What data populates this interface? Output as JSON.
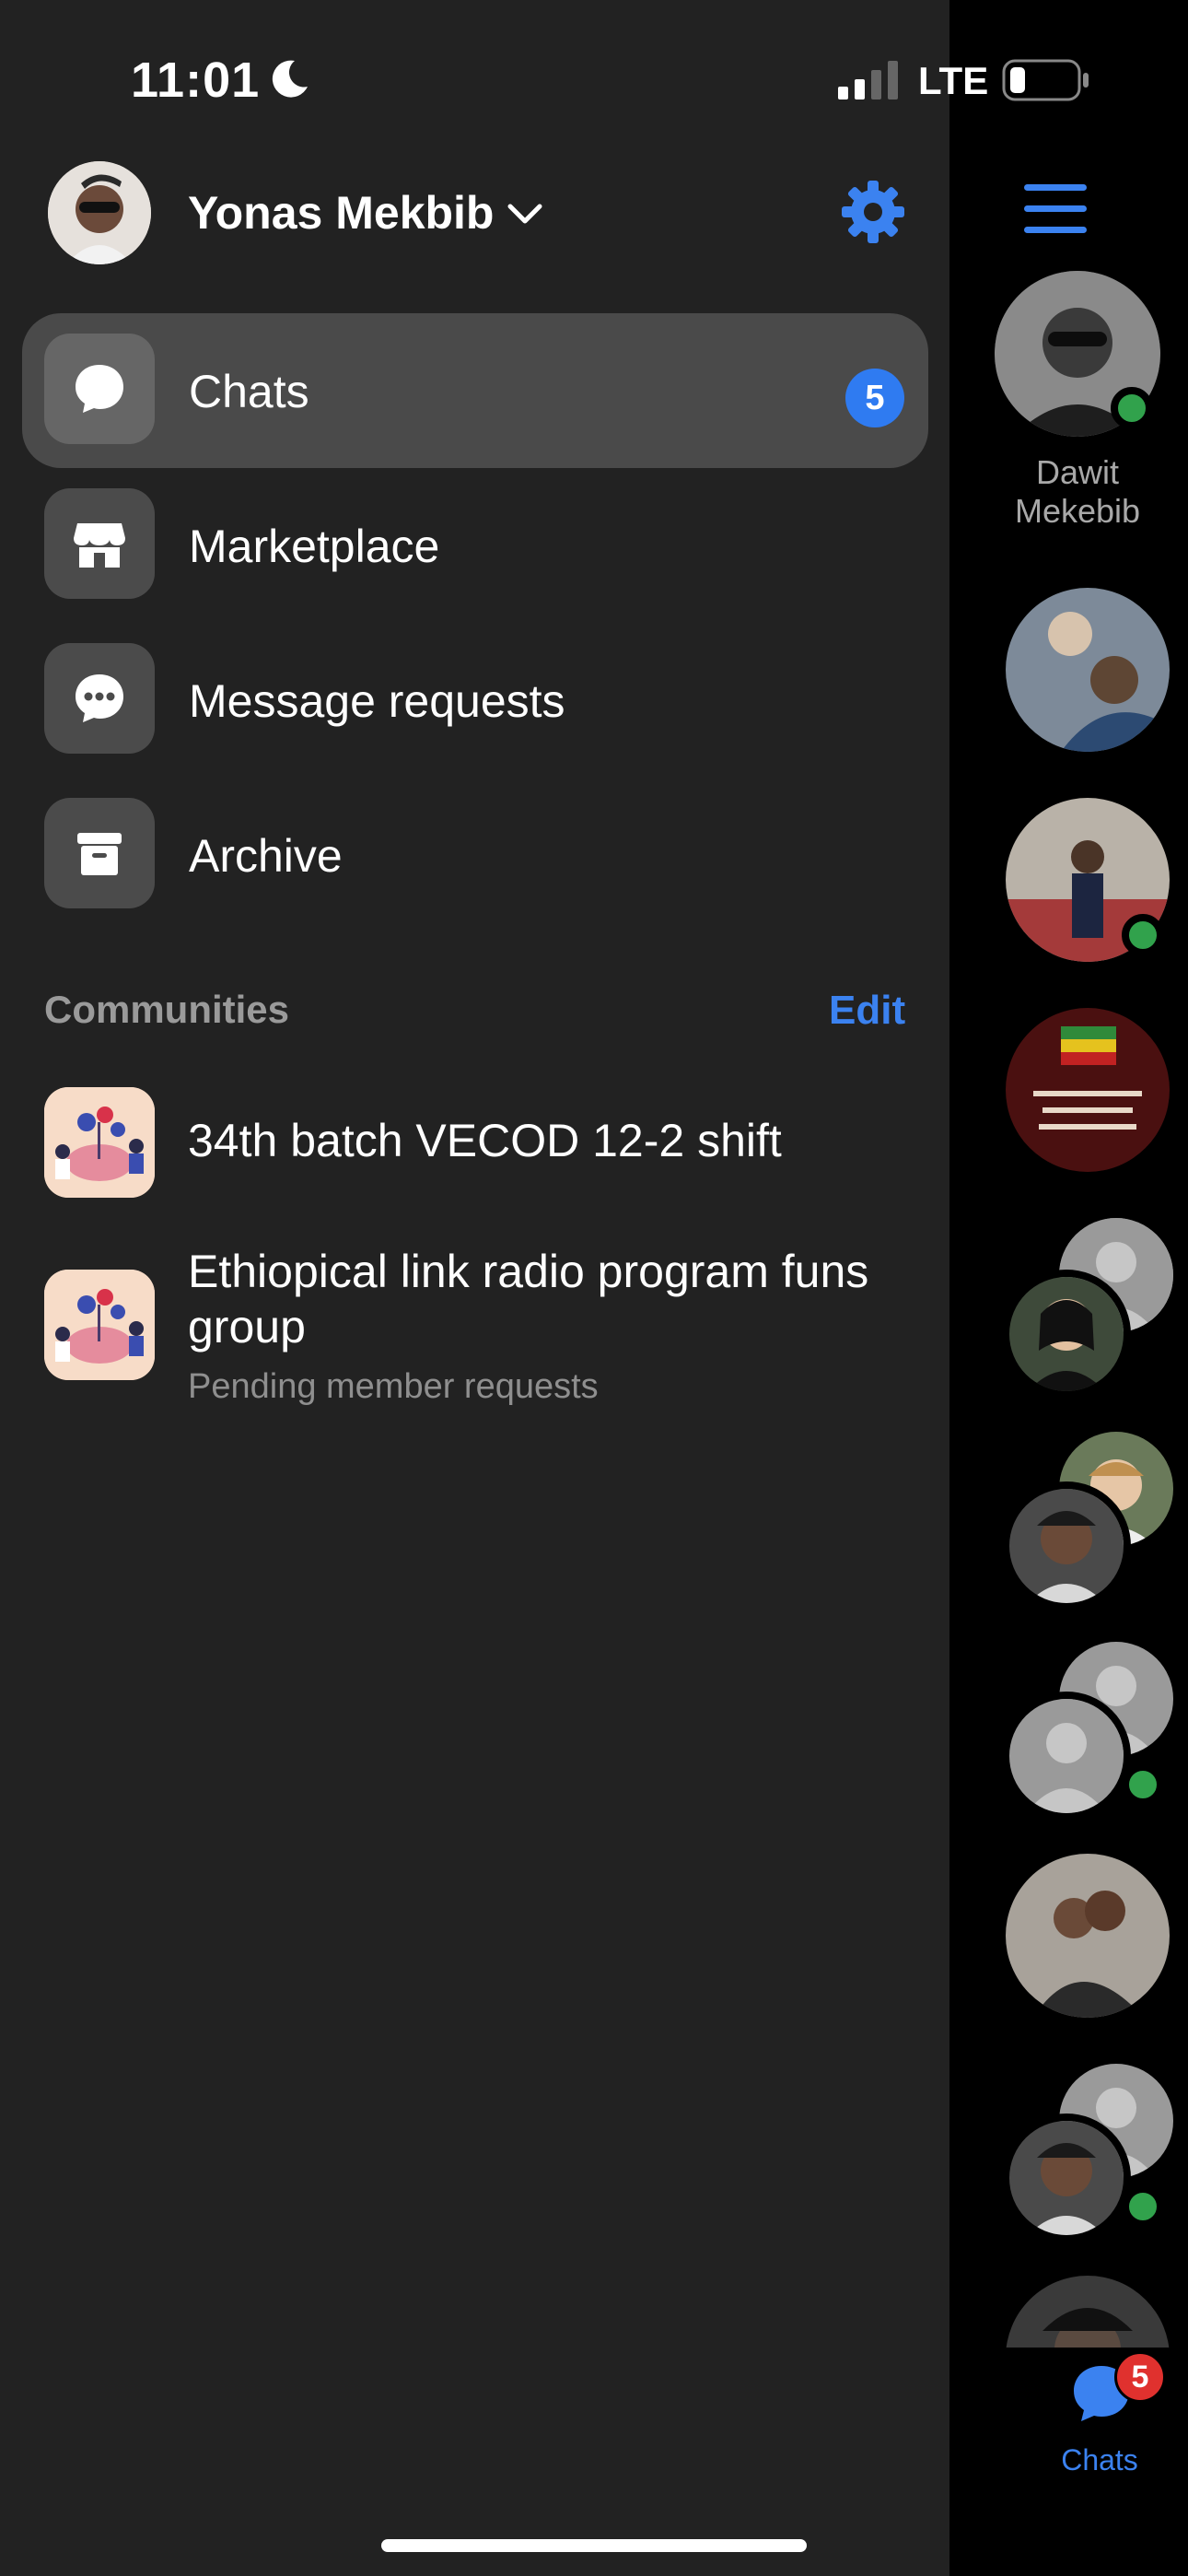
{
  "status_bar": {
    "time": "11:01",
    "network": "LTE"
  },
  "profile": {
    "name": "Yonas Mekbib"
  },
  "menu": [
    {
      "label": "Chats",
      "badge": "5",
      "icon": "chat-bubble-icon"
    },
    {
      "label": "Marketplace",
      "icon": "storefront-icon"
    },
    {
      "label": "Message requests",
      "icon": "message-dots-icon"
    },
    {
      "label": "Archive",
      "icon": "archive-box-icon"
    }
  ],
  "communities": {
    "title": "Communities",
    "edit_label": "Edit",
    "items": [
      {
        "name": "34th batch VECOD 12-2 shift"
      },
      {
        "name": "Ethiopical link radio program funs group",
        "subtitle": "Pending member requests"
      }
    ]
  },
  "rail": {
    "first_contact_name": "Dawit Mekebib",
    "bottom_tab_label": "Chats",
    "bottom_tab_badge": "5"
  },
  "colors": {
    "accent": "#3b82f0",
    "drawer_bg": "#222222",
    "online": "#31a24c",
    "badge_red": "#e0312e"
  }
}
